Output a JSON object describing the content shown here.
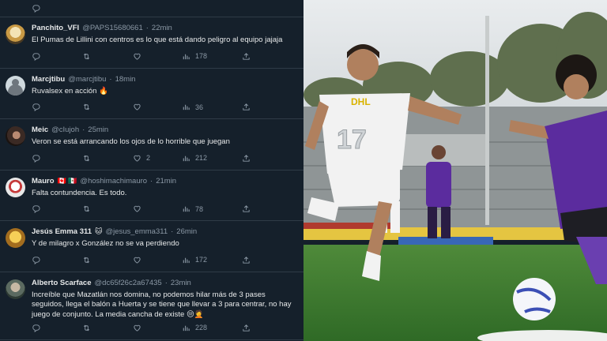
{
  "feed": {
    "tweets": [
      {
        "name": "Panchito_VFI",
        "flags": "",
        "handle": "@PAPS15680661",
        "time": "22min",
        "text": "El Pumas de Lillini con centros es lo que está dando peligro al equipo jajaja",
        "likes": "",
        "views": "178"
      },
      {
        "name": "Marcjtibu",
        "flags": "",
        "handle": "@marcjtibu",
        "time": "18min",
        "text": "Ruvalsex en acción 🔥",
        "likes": "",
        "views": "36"
      },
      {
        "name": "Meic",
        "flags": "",
        "handle": "@cIujoh",
        "time": "25min",
        "text": "Veron se está arrancando los ojos de lo horrible que juegan",
        "likes": "2",
        "views": "212"
      },
      {
        "name": "Mauro",
        "flags": "🇨🇦 🇲🇽",
        "handle": "@hoshimachimauro",
        "time": "21min",
        "text": "Falta contundencia. Es todo.",
        "likes": "",
        "views": "78"
      },
      {
        "name": "Jesús Emma 311",
        "flags": "🐱",
        "handle": "@jesus_emma311",
        "time": "26min",
        "text": "Y de milagro x González no se va perdiendo",
        "likes": "",
        "views": "172"
      },
      {
        "name": "Alberto Scarface",
        "flags": "",
        "handle": "@dc65f26c2a67435",
        "time": "23min",
        "text": "Increíble que Mazatlán nos domina, no podemos hilar más de 3 pases seguidos, llega el balón a Huerta y se tiene que llevar a 3 para centrar, no hay juego de conjunto. La media cancha de existe 😒🤦",
        "likes": "",
        "views": "228"
      }
    ],
    "dot": "·"
  },
  "photo": {
    "shirt_sponsor": "DHL",
    "shirt_number": "17",
    "description_icons": [
      "reply-icon",
      "retweet-icon",
      "like-icon",
      "views-icon",
      "share-icon"
    ]
  },
  "colors": {
    "background": "#15202b",
    "divider": "#2f3b47",
    "text": "#e7e9ea",
    "muted": "#8b98a5",
    "mazatlan_purple": "#5b2c9e",
    "pumas_white": "#f2f2f2"
  }
}
